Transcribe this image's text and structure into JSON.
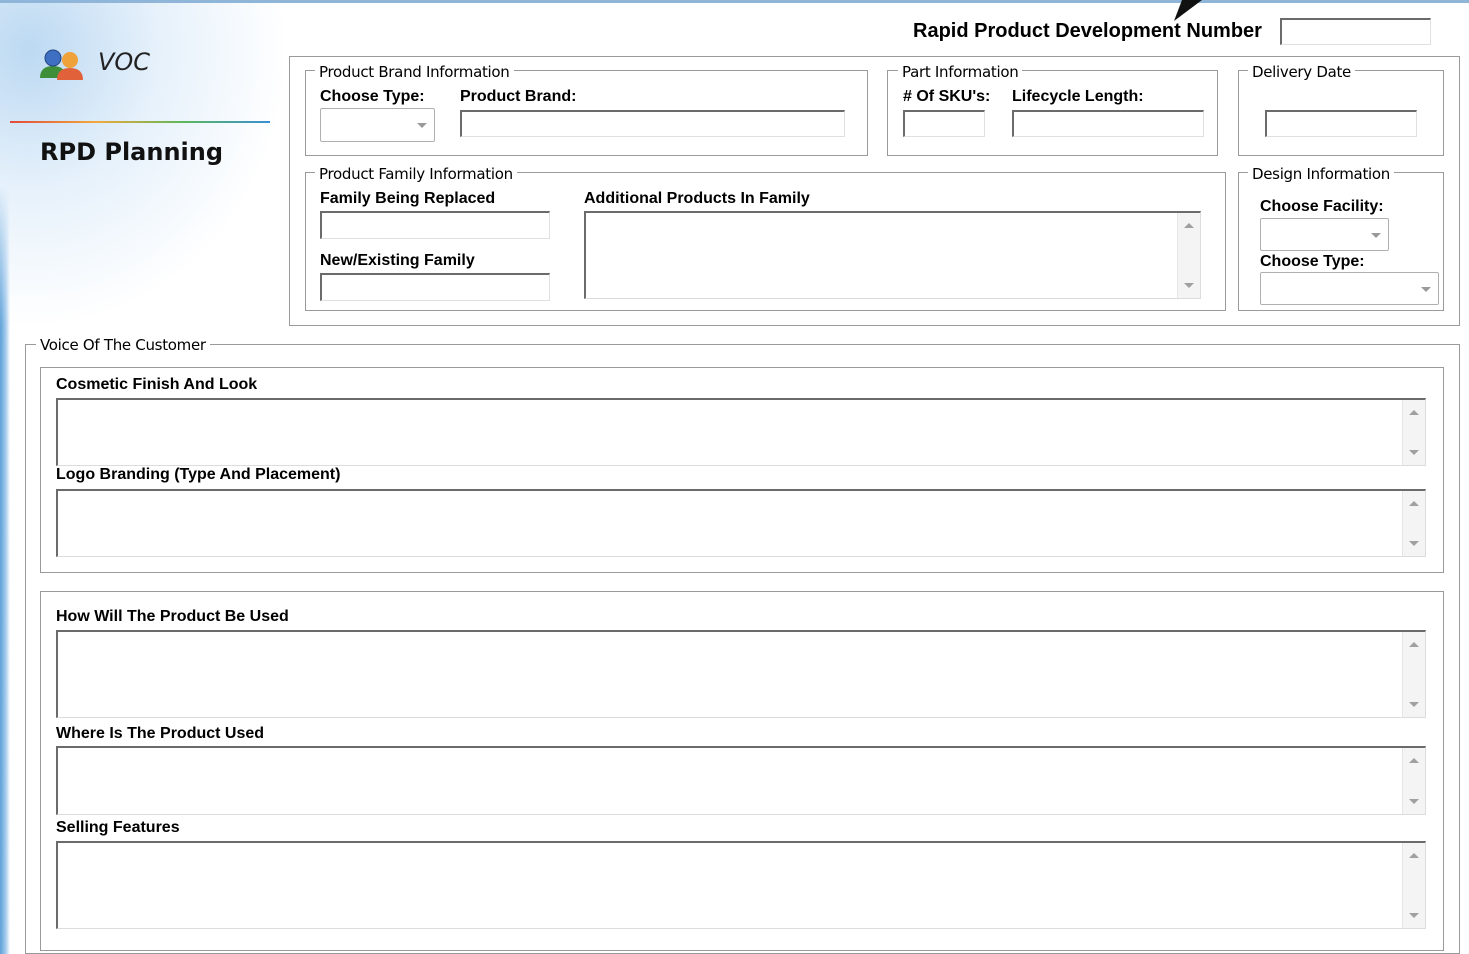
{
  "header": {
    "app_label": "VOC",
    "page_title": "RPD Planning",
    "rpd_number_label": "Rapid Product Development Number",
    "rpd_number_value": ""
  },
  "product_brand": {
    "caption": "Product Brand Information",
    "choose_type_label": "Choose Type:",
    "product_brand_label": "Product Brand:",
    "choose_type_value": "",
    "product_brand_value": ""
  },
  "part_info": {
    "caption": "Part Information",
    "skus_label": "# Of SKU's:",
    "lifecycle_label": "Lifecycle Length:",
    "skus_value": "",
    "lifecycle_value": ""
  },
  "delivery": {
    "caption": "Delivery Date",
    "value": ""
  },
  "product_family": {
    "caption": "Product Family Information",
    "family_replaced_label": "Family Being Replaced",
    "new_existing_label": "New/Existing Family",
    "additional_label": "Additional Products In Family",
    "family_replaced_value": "",
    "new_existing_value": "",
    "additional_value": ""
  },
  "design": {
    "caption": "Design Information",
    "facility_label": "Choose Facility:",
    "type_label": "Choose Type:",
    "facility_value": "",
    "type_value": ""
  },
  "voc": {
    "caption": "Voice Of The Customer",
    "cosmetic_label": "Cosmetic Finish And Look",
    "logo_label": "Logo Branding (Type And Placement)",
    "usage_label": "How Will The Product Be Used",
    "where_label": "Where Is The Product Used",
    "selling_label": "Selling Features",
    "cosmetic_value": "",
    "logo_value": "",
    "usage_value": "",
    "where_value": "",
    "selling_value": ""
  },
  "colors": {
    "frame_border": "#9a9a9a",
    "accent_gradient": [
      "#e14b3b",
      "#f2a93b",
      "#5cb85c",
      "#3a8fd6"
    ]
  },
  "icons": {
    "users": "users-icon",
    "scroll_up": "scroll-up-arrow",
    "scroll_down": "scroll-down-arrow",
    "dropdown": "dropdown-arrow",
    "pointer": "mouse-pointer-icon"
  }
}
